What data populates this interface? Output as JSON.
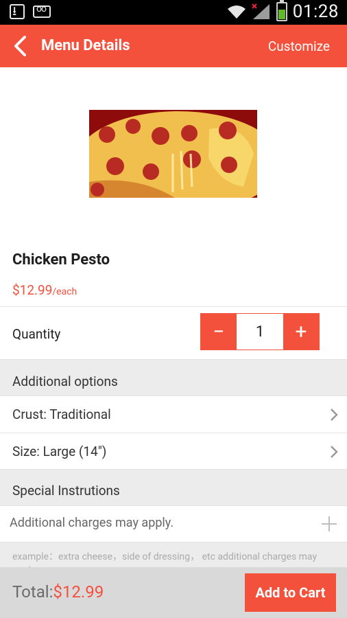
{
  "status_bar": {
    "time": "01:28",
    "icons": [
      "download-icon",
      "voicemail-icon",
      "wifi-icon",
      "signal-icon",
      "battery-icon"
    ]
  },
  "app_bar": {
    "title": "Menu Details",
    "action_label": "Customize",
    "accent_color": "#f4513d"
  },
  "product": {
    "name": "Chicken Pesto",
    "price": "$12.99",
    "unit": "/each"
  },
  "quantity": {
    "label": "Quantity",
    "value": "1",
    "decrement": "−",
    "increment": "+"
  },
  "additional_options": {
    "header": "Additional options",
    "items": [
      {
        "label": "Crust: Traditional"
      },
      {
        "label": "Size: Large (14\")"
      }
    ]
  },
  "special_instructions": {
    "header": "Special Instrutions",
    "placeholder": "Additional charges may apply.",
    "example": "example：extra cheese，side of dressing， etc additional charges may apply"
  },
  "footer": {
    "total_label": "Total:",
    "total_value": "$12.99",
    "add_to_cart": "Add to Cart"
  }
}
